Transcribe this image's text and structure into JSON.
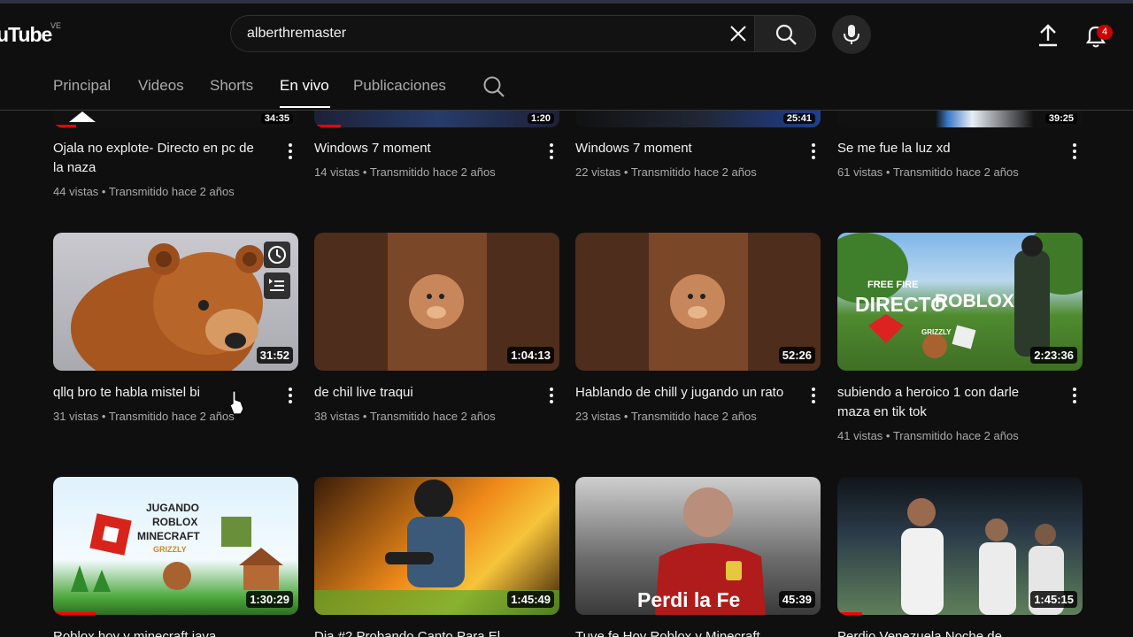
{
  "masthead": {
    "logo_text": "uTube",
    "logo_region": "VE",
    "search_value": "alberthremaster",
    "notification_count": "4",
    "icons": [
      "close-icon",
      "search-icon",
      "mic-icon",
      "upload-icon",
      "bell-icon"
    ]
  },
  "tabs": [
    {
      "label": "Principal",
      "active": false
    },
    {
      "label": "Videos",
      "active": false
    },
    {
      "label": "Shorts",
      "active": false
    },
    {
      "label": "En vivo",
      "active": true
    },
    {
      "label": "Publicaciones",
      "active": false
    }
  ],
  "top_row": [
    {
      "duration": "34:35",
      "title": "Ojala no explote- Directo en pc de la naza",
      "meta": "44 vistas • Transmitido hace 2 años"
    },
    {
      "duration": "1:20",
      "title": "Windows 7 moment",
      "meta": "14 vistas • Transmitido hace 2 años"
    },
    {
      "duration": "25:41",
      "title": "Windows 7 moment",
      "meta": "22 vistas • Transmitido hace 2 años"
    },
    {
      "duration": "39:25",
      "title": "Se me fue la luz xd",
      "meta": "61 vistas • Transmitido hace 2 años"
    }
  ],
  "mid_row": [
    {
      "duration": "31:52",
      "title": "qllq bro te habla mistel bi",
      "meta": "31 vistas • Transmitido hace 2 años",
      "thumb": "bear"
    },
    {
      "duration": "1:04:13",
      "title": "de chil live traqui",
      "meta": "38 vistas • Transmitido hace 2 años",
      "thumb": "brown-avatar"
    },
    {
      "duration": "52:26",
      "title": "Hablando de chill y jugando un rato",
      "meta": "23 vistas • Transmitido hace 2 años",
      "thumb": "brown-avatar"
    },
    {
      "duration": "2:23:36",
      "title": "subiendo a heroico 1 con darle maza en tik tok",
      "meta": "41 vistas • Transmitido hace 2 años",
      "thumb": "freefire",
      "thumb_text": [
        "FREE FIRE",
        "DIRECTO",
        "ROBLOX",
        "GRIZZLY"
      ]
    }
  ],
  "bottom_row": [
    {
      "duration": "1:30:29",
      "thumb_text": [
        "JUGANDO",
        "ROBLOX",
        "MINECRAFT",
        "GRIZZLY"
      ],
      "title_partial": "Roblox hoy y minecraft java"
    },
    {
      "duration": "1:45:49",
      "title_partial": "Dia #2 Probando Canto Para El"
    },
    {
      "duration": "45:39",
      "thumb_text": [
        "Perdi la Fe"
      ],
      "title_partial": "Tuve fe Hoy Roblox y Minecraft"
    },
    {
      "duration": "1:45:15",
      "title_partial": "Perdio Venezuela Noche de"
    }
  ]
}
